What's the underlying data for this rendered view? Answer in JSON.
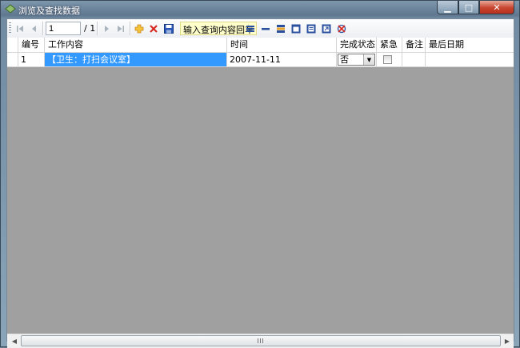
{
  "window": {
    "title": "浏览及查找数据"
  },
  "toolbar": {
    "position": "1",
    "count": "/ 1",
    "search_label": "输入查询内容回车"
  },
  "grid": {
    "columns": [
      "编号",
      "工作内容",
      "时间",
      "完成状态",
      "紧急",
      "备注",
      "最后日期"
    ],
    "rows": [
      {
        "id": "1",
        "content": "【卫生：打扫会议室】",
        "time": "2007-11-11",
        "status": "否",
        "urgent": false,
        "note": "",
        "last_date": ""
      }
    ]
  },
  "colors": {
    "selection": "#3399ff",
    "empty_area": "#a0a0a0"
  }
}
